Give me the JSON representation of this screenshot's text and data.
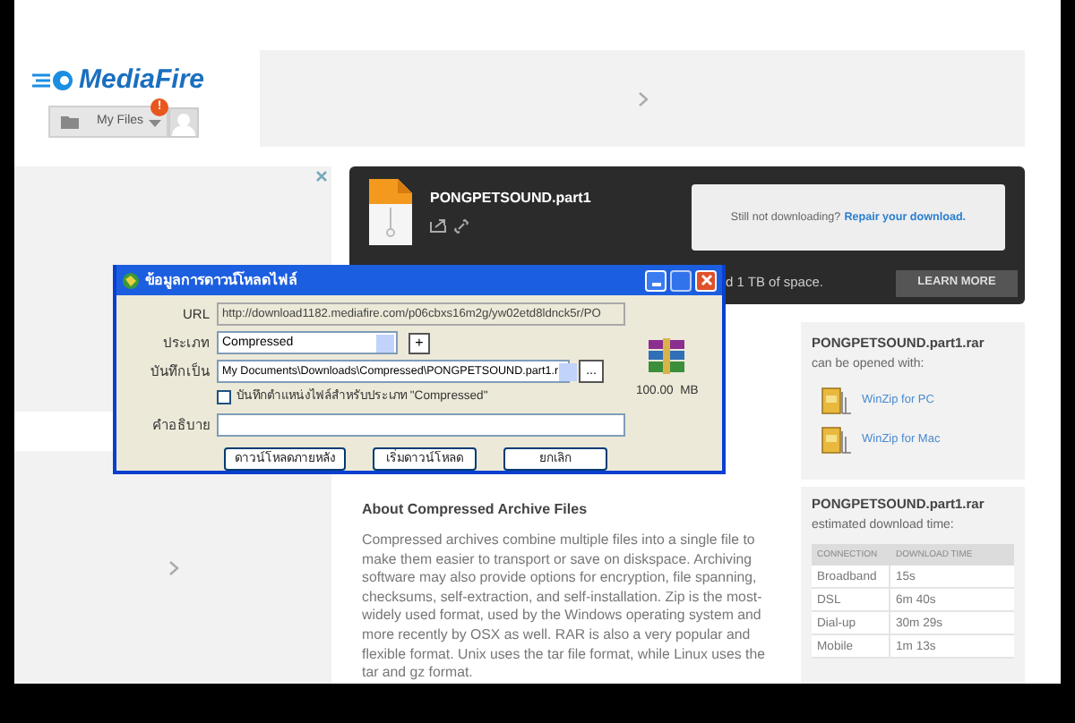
{
  "header": {
    "logo": "MediaFire",
    "my_files_button": "My Files",
    "notification_badge": "!"
  },
  "banner": {
    "file_name": "PONGPETSOUND.part1",
    "repair_prompt": "Still not downloading?",
    "repair_link": "Repair your download.",
    "storage_text": "d 1 TB of space.",
    "learn_more_button": "LEARN MORE"
  },
  "dialog": {
    "title": "ข้อมูลการดาวน์โหลดไฟล์",
    "fields": [
      {
        "kind": "text",
        "label": "URL",
        "value": "http://download1182.mediafire.com/p06cbxs16m2g/yw02etd8ldnck5r/PO"
      },
      {
        "kind": "dropdown",
        "label": "ประเภท",
        "value": "Compressed",
        "add_button": "+"
      },
      {
        "kind": "path",
        "label": "บันทึกเป็น",
        "value": "My Documents\\Downloads\\Compressed\\PONGPETSOUND.part1.r",
        "browse_button": "..."
      }
    ],
    "remember_checkbox": {
      "label": "บันทึกตำแหน่งไฟล์สำหรับประเภท \"Compressed\"",
      "checked": false
    },
    "description_label": "คำอธิบาย",
    "file_size": "100.00  MB",
    "buttons": [
      "ดาวน์โหลดภายหลัง",
      "เริ่มดาวน์โหลด",
      "ยกเลิก"
    ]
  },
  "about": {
    "title": "About Compressed Archive Files",
    "body": "Compressed archives combine multiple files into a single file to make them easier to transport or save on diskspace. Archiving software may also provide options for encryption, file spanning, checksums, self-extraction, and self-installation. Zip is the most-widely used format, used by the Windows operating system and more recently by OSX as well. RAR is also a very popular and flexible format. Unix uses the tar file format, while Linux uses the tar and gz format."
  },
  "opened_with": {
    "file_name": "PONGPETSOUND.part1.rar",
    "caption": "can be opened with:",
    "apps": [
      "WinZip for PC",
      "WinZip for Mac"
    ]
  },
  "download_time": {
    "file_name": "PONGPETSOUND.part1.rar",
    "caption": "estimated download time:",
    "columns": [
      "CONNECTION",
      "DOWNLOAD TIME"
    ],
    "rows": [
      [
        "Broadband",
        "15s"
      ],
      [
        "DSL",
        "6m 40s"
      ],
      [
        "Dial-up",
        "30m 29s"
      ],
      [
        "Mobile",
        "1m 13s"
      ]
    ]
  }
}
